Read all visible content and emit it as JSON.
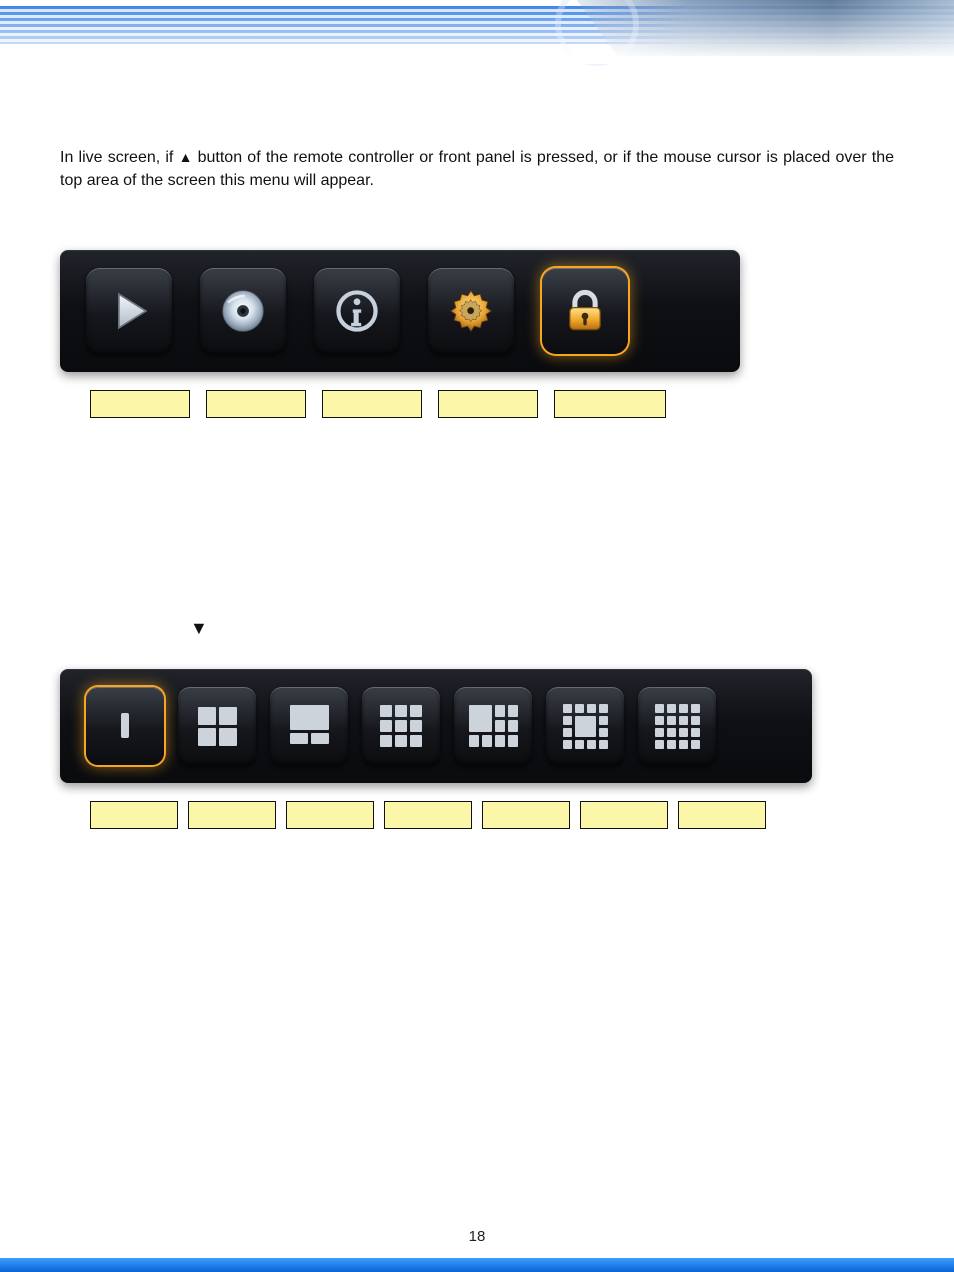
{
  "paragraph": {
    "pre": "In live screen, if ",
    "tri": "▲",
    "post": " button of the remote controller or front panel is pressed, or if the mouse cursor is placed over the top area of the screen this menu will appear."
  },
  "toolbar1": {
    "buttons": [
      {
        "name": "play-button",
        "icon": "play-icon",
        "selected": false
      },
      {
        "name": "disc-button",
        "icon": "disc-icon",
        "selected": false
      },
      {
        "name": "info-button",
        "icon": "info-icon",
        "selected": false
      },
      {
        "name": "setup-button",
        "icon": "gear-icon",
        "selected": false
      },
      {
        "name": "lock-button",
        "icon": "lock-icon",
        "selected": true
      }
    ],
    "labels": [
      "",
      "",
      "",
      "",
      ""
    ]
  },
  "mid_tri": "▼",
  "toolbar2": {
    "buttons": [
      {
        "name": "layout-1",
        "selected": true
      },
      {
        "name": "layout-4",
        "selected": false
      },
      {
        "name": "layout-6",
        "selected": false
      },
      {
        "name": "layout-9",
        "selected": false
      },
      {
        "name": "layout-10",
        "selected": false
      },
      {
        "name": "layout-13",
        "selected": false
      },
      {
        "name": "layout-16",
        "selected": false
      }
    ],
    "labels": [
      "",
      "",
      "",
      "",
      "",
      "",
      ""
    ]
  },
  "page_number": "18"
}
